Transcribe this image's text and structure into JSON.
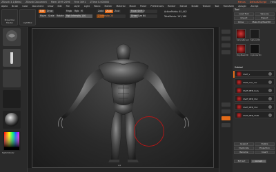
{
  "titlebar": {
    "app": "ZBrush",
    "items": [
      "ZBrush 3.1(Beta)",
      "ZBrush Document",
      "Mem 1599 2096",
      "Free 3091",
      "ZTime 0.000000"
    ],
    "right_items": [
      "Menus",
      "DefaultZScript",
      "Help"
    ]
  },
  "menubar": [
    "Alpha",
    "Brush",
    "Color",
    "Document",
    "Draw",
    "Edit",
    "File",
    "Layer",
    "Light",
    "Macro",
    "Marker",
    "Material",
    "Movie",
    "Picker",
    "Preferences",
    "Render",
    "Stencil",
    "Stroke",
    "Texture",
    "Tool",
    "Transform",
    "Zplugin",
    "Zscript"
  ],
  "toolbar": {
    "projection_master": "Projection Master",
    "lightbox": "LightBox",
    "edit": "Edit",
    "draw": "Draw",
    "move": "Move",
    "scale": "Scale",
    "rotate": "Rotate",
    "mrgb": "Mrgb",
    "rgb": "Rgb",
    "m": "M",
    "zadd": "Zadd",
    "zsub": "Zsub",
    "zcut": "Zcut",
    "rgb_intensity": "Rgb Intensity 100",
    "z_intensity": "Z Intensity 25",
    "focal_shift": "Focal Shift 0",
    "draw_size": "Draw Size 64",
    "active_points": "ActivePoints: 61,442",
    "total_points": "TotalPoints: 191,168"
  },
  "leftshelf": {
    "brush_label": "",
    "stroke_label": "",
    "alpha_label": "",
    "material_label": "",
    "color_label": "SwitchColor"
  },
  "rightpanel": {
    "title": "Tool",
    "buttons_row1": [
      "Load Tool",
      "Save As"
    ],
    "buttons_row2": [
      "Import",
      "Export"
    ],
    "buttons_row3": [
      "Clone",
      "Make PolyMesh3D"
    ],
    "goz": "Subtool",
    "thumbs": [
      "SimpleBrush",
      "Sphere3D",
      "PolyMesh3D",
      "Cylinder3D"
    ],
    "subtools": [
      "Shaff_v",
      "Shaff_mes_mir",
      "Shaff_MEB_body",
      "Shaff_MEB_Shd",
      "Shaff_MEB_Shd",
      "Shaff_MEB_ShdR"
    ],
    "bottom": [
      "Append",
      "Delete",
      "Duplicate",
      "Projection",
      "Rename",
      "Insert"
    ],
    "extract": "Extract",
    "accept": "Accept"
  },
  "colors": {
    "accent": "#e36b19",
    "brush_ring": "#b01818",
    "panel": "#2d2d2d"
  }
}
